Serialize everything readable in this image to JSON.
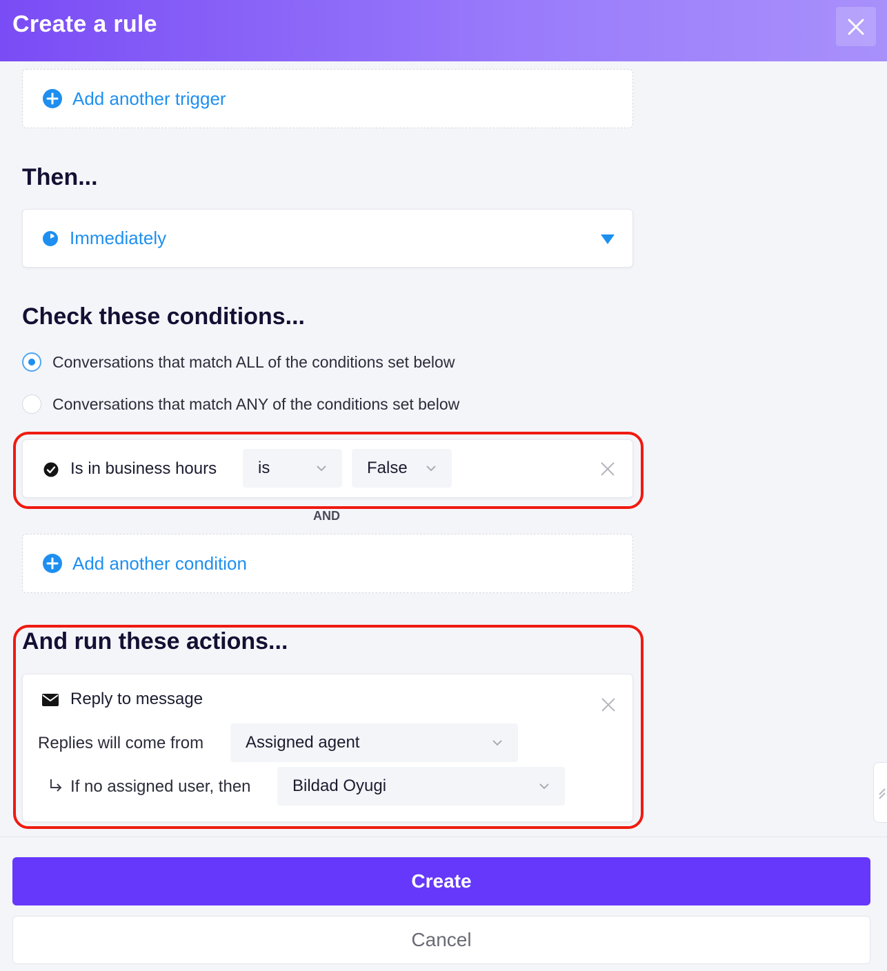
{
  "header": {
    "title": "Create a rule"
  },
  "trigger": {
    "add_label": "Add another trigger"
  },
  "then": {
    "title": "Then...",
    "timing_value": "Immediately"
  },
  "conditions": {
    "title": "Check these conditions...",
    "match_all_label": "Conversations that match ALL of the conditions set below",
    "match_any_label": "Conversations that match ANY of the conditions set below",
    "selected": "all",
    "items": [
      {
        "field": "Is in business hours",
        "operator": "is",
        "value": "False"
      }
    ],
    "joiner": "AND",
    "add_label": "Add another condition"
  },
  "actions": {
    "title": "And run these actions...",
    "items": [
      {
        "type": "Reply to message",
        "from_label": "Replies will come from",
        "from_value": "Assigned agent",
        "fallback_label": "If no assigned user, then",
        "fallback_value": "Bildad Oyugi"
      }
    ]
  },
  "footer": {
    "create_label": "Create",
    "cancel_label": "Cancel"
  },
  "colors": {
    "accent": "#1e8ff0",
    "primary_button": "#6538fb",
    "header_gradient_start": "#7a4cf5",
    "highlight": "#ef1a10"
  }
}
